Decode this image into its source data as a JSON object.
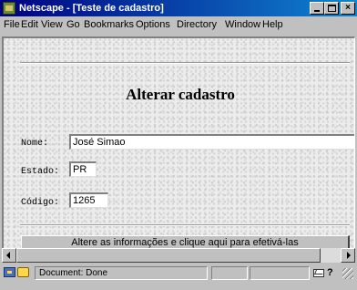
{
  "window": {
    "title": "Netscape - [Teste de cadastro]",
    "title_bar_color": "#000080",
    "icons": [
      "netscape-icon",
      "minimize-icon",
      "maximize-icon",
      "close-icon"
    ]
  },
  "menubar": {
    "items": [
      "File",
      "Edit",
      "View",
      "Go",
      "Bookmarks",
      "Options",
      "Directory",
      "Window",
      "Help"
    ]
  },
  "page": {
    "heading": "Alterar cadastro",
    "fields": {
      "nome": {
        "label": "Nome:",
        "value": "José Simao"
      },
      "estado": {
        "label": "Estado:",
        "value": "PR"
      },
      "codigo": {
        "label": "Código:",
        "value": "1265"
      }
    },
    "submit_label": "Altere as informações e clique aqui para efetivá-las"
  },
  "statusbar": {
    "text": "Document: Done",
    "icons": [
      "key-icon",
      "security-icon",
      "mail-icon",
      "help-icon",
      "resize-grip-icon"
    ]
  },
  "colors": {
    "chrome": "#c0c0c0",
    "page_background": "#ececec"
  }
}
